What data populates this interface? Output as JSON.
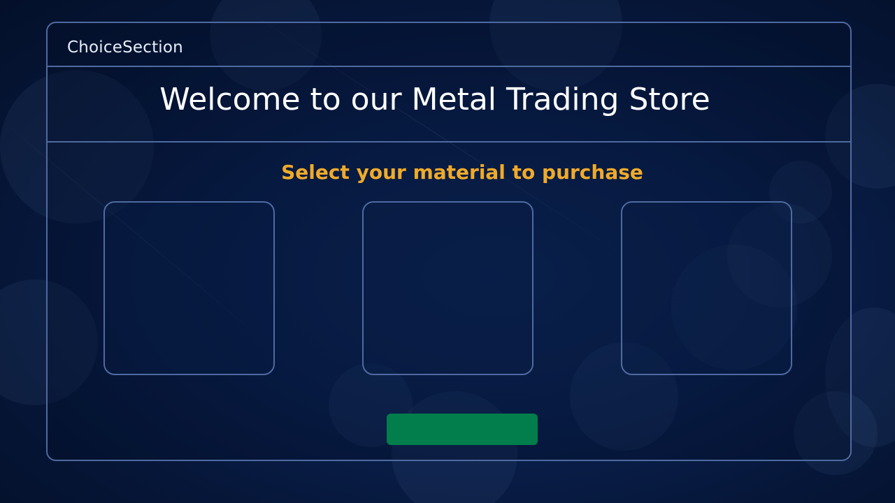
{
  "choice_section": {
    "label": "ChoiceSection",
    "welcome_title": "Welcome to our Metal Trading Store",
    "subtitle": "Select your material to purchase",
    "options": [
      {
        "label": ""
      },
      {
        "label": ""
      },
      {
        "label": ""
      }
    ],
    "action_button": {
      "label": ""
    }
  },
  "colors": {
    "background": "#061638",
    "panel_border": "#4f6aa0",
    "subtitle": "#f0aa2a",
    "button": "#017e4b",
    "text": "#ffffff"
  }
}
